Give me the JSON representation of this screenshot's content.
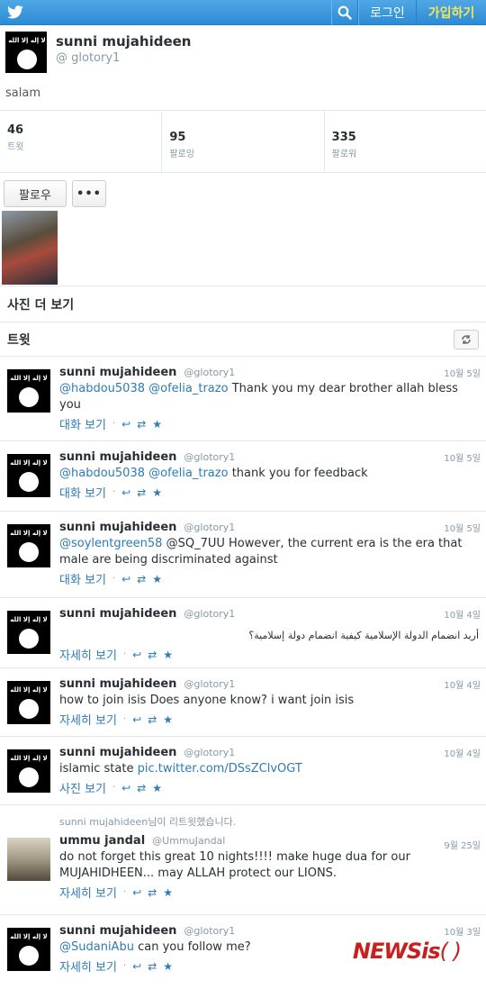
{
  "topbar": {
    "logo_icon": "twitter-bird-icon",
    "search_icon": "search-icon",
    "login_label": "로그인",
    "signup_label": "가입하기"
  },
  "profile": {
    "name": "sunni mujahideen",
    "handle": "@ glotory1",
    "bio": "salam",
    "flag_text": "لا إله إلا الله",
    "seal_text": "محمد رسول الله"
  },
  "stats": [
    {
      "num": "46",
      "label": "트윗"
    },
    {
      "num": "95",
      "label": "팔로잉"
    },
    {
      "num": "335",
      "label": "팔로워"
    }
  ],
  "actions": {
    "follow_label": "팔로우",
    "more_label": "•••"
  },
  "sections": {
    "photos_more": "사진 더 보기",
    "tweets": "트윗"
  },
  "tweets": [
    {
      "name": "sunni mujahideen",
      "handle": "@glotory1",
      "date": "10월 5일",
      "mentions": [
        "@habdou5038",
        "@ofelia_trazo"
      ],
      "text": "Thank you my dear brother allah bless you",
      "action_link": "대화 보기"
    },
    {
      "name": "sunni mujahideen",
      "handle": "@glotory1",
      "date": "10월 5일",
      "mentions": [
        "@habdou5038",
        "@ofelia_trazo"
      ],
      "text": "thank you for feedback",
      "action_link": "대화 보기"
    },
    {
      "name": "sunni mujahideen",
      "handle": "@glotory1",
      "date": "10월 5일",
      "mentions": [
        "@soylentgreen58"
      ],
      "text": "@SQ_7UU However, the current era is the era that male are being discriminated against",
      "action_link": "대화 보기"
    },
    {
      "name": "sunni mujahideen",
      "handle": "@glotory1",
      "date": "10월 4일",
      "mentions": [],
      "text": "أريد انضمام الدولة الإسلامية كيفية انضمام دولة إسلامية؟",
      "action_link": "자세히 보기"
    },
    {
      "name": "sunni mujahideen",
      "handle": "@glotory1",
      "date": "10월 4일",
      "mentions": [],
      "text": "how to join isis Does anyone know? i want join isis",
      "action_link": "자세히 보기"
    },
    {
      "name": "sunni mujahideen",
      "handle": "@glotory1",
      "date": "10월 4일",
      "mentions": [],
      "text": "islamic state",
      "link": "pic.twitter.com/DSsZClvOGT",
      "action_link": "사진 보기"
    },
    {
      "retweet_note": "sunni mujahideen님이 리트윗했습니다.",
      "name": "ummu jandal",
      "handle": "@UmmuJandal",
      "date": "9월 25일",
      "mentions": [],
      "text": "do not forget this great 10 nights!!!! make huge dua for our MUJAHIDHEEN... may ALLAH protect our LIONS.",
      "action_link": "자세히 보기"
    },
    {
      "name": "sunni mujahideen",
      "handle": "@glotory1",
      "date": "10월 3일",
      "mentions": [
        "@SudaniAbu"
      ],
      "text": "can you follow me?",
      "action_link": "자세히 보기"
    }
  ],
  "action_icons": {
    "reply": "↩",
    "retweet": "⇄",
    "favorite": "★"
  },
  "watermark": {
    "text": "NEWSis",
    "parens": "( )"
  }
}
